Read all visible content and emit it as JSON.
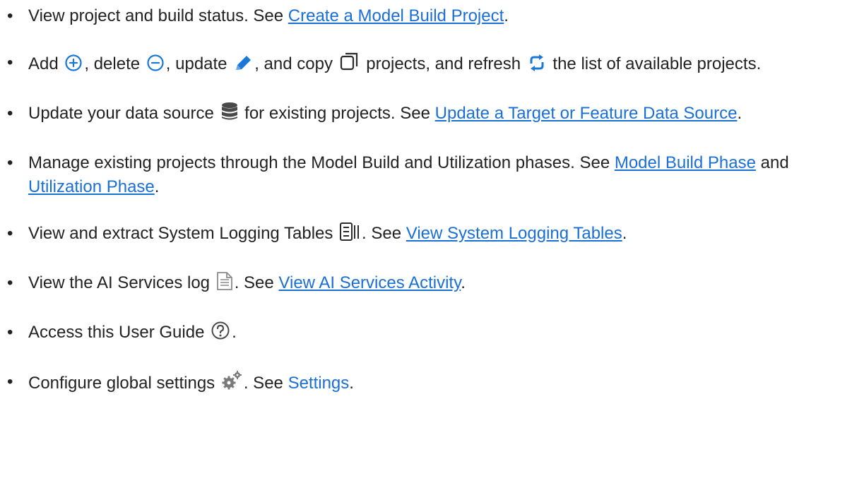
{
  "items": [
    {
      "t0": "View project and build status. See ",
      "link": "Create a Model Build Project",
      "t1": "."
    },
    {
      "t0": "Add ",
      "t1": ", delete ",
      "t2": ", update ",
      "t3": ", and copy ",
      "t4": " projects, and refresh ",
      "t5": " the list of available projects.",
      "icons": [
        "add-circle-icon",
        "minus-circle-icon",
        "pencil-icon",
        "copy-icon",
        "refresh-icon"
      ]
    },
    {
      "t0": "Update your data source ",
      "t1": " for existing projects. See ",
      "link": "Update a Target or Feature Data Source",
      "t2": ".",
      "icons": [
        "database-icon"
      ]
    },
    {
      "t0": "Manage existing projects through the Model Build and Utilization phases. See ",
      "link1": "Model Build Phase",
      "t1": " and ",
      "link2": "Utilization Phase",
      "t2": "."
    },
    {
      "t0": "View and extract System Logging Tables ",
      "t1": ". See ",
      "link": "View System Logging Tables",
      "t2": ".",
      "icons": [
        "logging-tables-icon"
      ]
    },
    {
      "t0": "View the AI Services log ",
      "t1": ". See ",
      "link": "View AI Services Activity",
      "t2": ".",
      "icons": [
        "document-icon"
      ]
    },
    {
      "t0": "Access this User Guide ",
      "t1": ".",
      "icons": [
        "help-circle-icon"
      ]
    },
    {
      "t0": "Configure global settings ",
      "t1": ". See ",
      "link": "Settings",
      "t2": ".",
      "icons": [
        "gear-icon"
      ]
    }
  ],
  "colors": {
    "text": "#222222",
    "link": "#1a6fd6",
    "icon_blue": "#1a78d8",
    "icon_dark": "#2b2b2b",
    "icon_gray": "#8a8a8a"
  }
}
